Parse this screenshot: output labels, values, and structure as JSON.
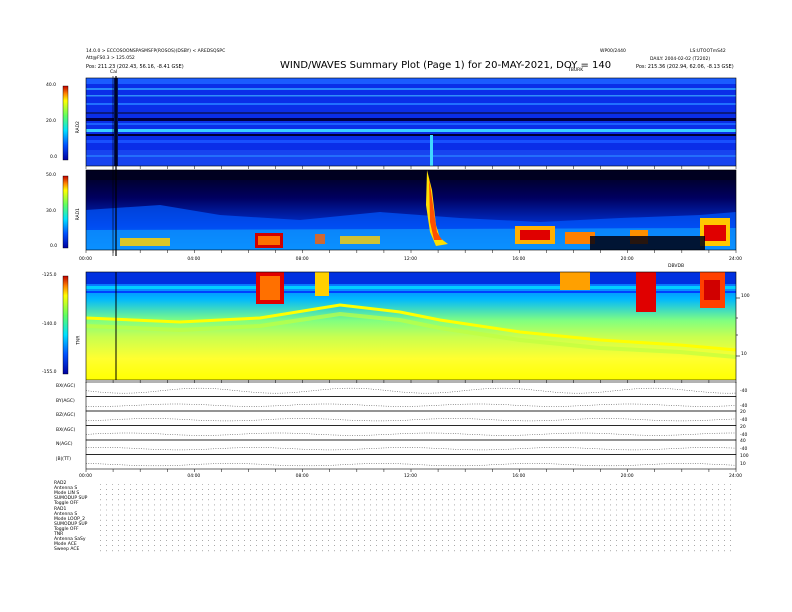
{
  "header": {
    "title": "WIND/WAVES Summary Plot (Page 1) for 20-MAY-2021, DOY = 140",
    "left_line1": "14.0.0 > ECCOSOONSPASMSFP(ROSOS)(DSBY) < AREDSQSPC",
    "left_line2": "Att@FS0.3 > 125.052",
    "left_pos": "Pos:   211.23 (202.43, 56.16, -8.41 GSE)",
    "right_line1": "WP00/2440",
    "right_line2": "LS:UTOOTmS42",
    "right_line3": "DAILY: 2004-02-02 (T2202)",
    "right_pos": "Pos:   215.36 (202.94, 62.06, -8.13 GSE)",
    "ticks_label": "TBURK",
    "cal_label": "Cal"
  },
  "panels": {
    "rad2": {
      "name": "RAD2",
      "ticks": [
        "40.0",
        "20.0",
        "0.0"
      ]
    },
    "rad1": {
      "name": "RAD1",
      "ticks": [
        "50.0",
        "30.0",
        "0.0"
      ]
    },
    "tnr": {
      "name": "TNR",
      "ticks": [
        "-125.0",
        "-140.0",
        "-155.0"
      ],
      "right_ticks": [
        "100",
        "10"
      ],
      "top_note": "DBVDB"
    }
  },
  "time_axis": {
    "labels": [
      "00:00",
      "04:00",
      "08:00",
      "12:00",
      "16:00",
      "20:00",
      "24:00"
    ]
  },
  "strips": [
    {
      "label": "BX(AGC)",
      "right": [
        "",
        "-40"
      ]
    },
    {
      "label": "BY(AGC)",
      "right": [
        "",
        "-40"
      ]
    },
    {
      "label": "BZ(AGC)",
      "right": [
        "20",
        "-40"
      ]
    },
    {
      "label": "BX(AGC)",
      "right": [
        "20",
        "-40"
      ]
    },
    {
      "label": "N(AGC)",
      "right": [
        "40",
        "-40"
      ]
    },
    {
      "label": "|B|(TT)",
      "right": [
        "100",
        "10"
      ]
    }
  ],
  "status": {
    "rows": [
      "RAD2",
      "Antenna  S",
      "Mode  LIN S",
      "SUMODUP SUP",
      "Toggle  OFF",
      "RAD1",
      "Antenna  S",
      "Mode  LOOP_2",
      "SUMODUP SUP",
      "Toggle  OFF",
      "TNR",
      "Antenna  SaSy",
      "Mode  ACE",
      "Sweep  ACE"
    ]
  },
  "colors": {
    "deep_blue": "#0000b4",
    "blue": "#1e3cff",
    "cyan": "#00c8ff",
    "green": "#46e650",
    "yellow": "#ffff00",
    "orange": "#ff8c00",
    "red": "#dc0000",
    "black": "#000000"
  }
}
